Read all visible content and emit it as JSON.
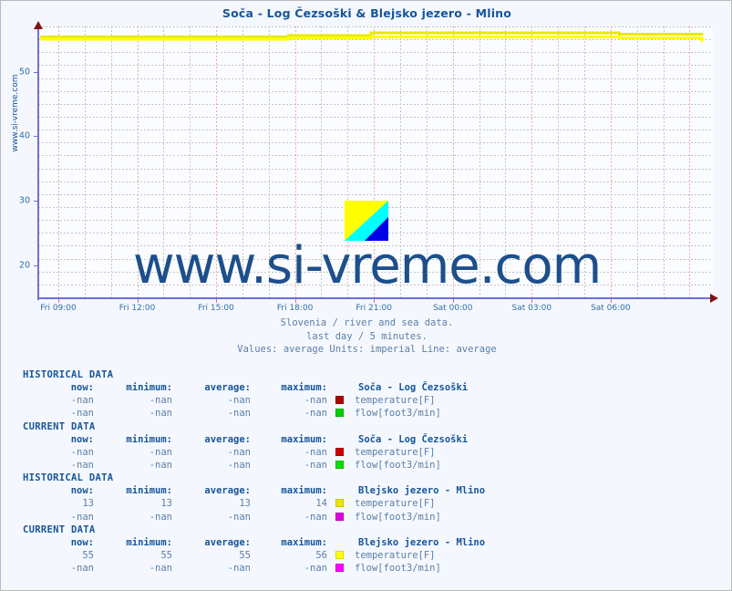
{
  "chart_title": "Soča - Log Čezsoški & Blejsko jezero - Mlino",
  "side_watermark": "www.si-vreme.com",
  "big_watermark": "www.si-vreme.com",
  "logo": {
    "name": "si-vreme-logo",
    "colors": {
      "top": "#ffff00",
      "middle": "#00ffff",
      "bottom": "#0000e6"
    }
  },
  "caption": {
    "line1": "Slovenia / river and sea data.",
    "line2": "last day / 5 minutes.",
    "line3": "Values: average  Units: imperial  Line: average"
  },
  "chart_data": {
    "type": "line",
    "title": "Soča - Log Čezsoški & Blejsko jezero - Mlino",
    "xlabel": "",
    "ylabel": "",
    "ylim": [
      15,
      57
    ],
    "yticks": [
      20,
      30,
      40,
      50
    ],
    "grid": true,
    "legend_position": "below-table",
    "x": [
      "Fri 09:00",
      "Fri 12:00",
      "Fri 15:00",
      "Fri 18:00",
      "Fri 21:00",
      "Sat 00:00",
      "Sat 03:00",
      "Sat 06:00"
    ],
    "xtick_labels": [
      "Fri 09:00",
      "Fri 12:00",
      "Fri 15:00",
      "Fri 18:00",
      "Fri 21:00",
      "Sat 00:00",
      "Sat 03:00",
      "Sat 06:00"
    ],
    "series": [
      {
        "name": "Blejsko jezero - Mlino temperature[F] (maximum)",
        "color": "#e8e800",
        "values": [
          55.4,
          55.4,
          55.4,
          55.6,
          56.0,
          56.0,
          56.0,
          55.8,
          55.6
        ]
      },
      {
        "name": "Blejsko jezero - Mlino temperature[F] (average)",
        "color": "#ffff00",
        "values": [
          55.0,
          55.0,
          55.0,
          55.2,
          55.4,
          55.4,
          55.4,
          55.2,
          54.6
        ]
      },
      {
        "name": "Soča - Log Čezsoški temperature[F]",
        "color": "#b00000",
        "values": [
          null,
          null,
          null,
          null,
          null,
          null,
          null,
          null,
          null
        ]
      },
      {
        "name": "Soča - Log Čezsoški flow[foot3/min]",
        "color": "#00d000",
        "values": [
          null,
          null,
          null,
          null,
          null,
          null,
          null,
          null,
          null
        ]
      },
      {
        "name": "Blejsko jezero - Mlino flow[foot3/min]",
        "color": "#ff00ff",
        "values": [
          null,
          null,
          null,
          null,
          null,
          null,
          null,
          null,
          null
        ]
      }
    ]
  },
  "columns": [
    "now:",
    "minimum:",
    "average:",
    "maximum:"
  ],
  "blocks": [
    {
      "title": "HISTORICAL DATA",
      "station": "Soča - Log Čezsoški",
      "rows": [
        {
          "now": "-nan",
          "minimum": "-nan",
          "average": "-nan",
          "maximum": "-nan",
          "color": "#b00000",
          "label": "temperature[F]"
        },
        {
          "now": "-nan",
          "minimum": "-nan",
          "average": "-nan",
          "maximum": "-nan",
          "color": "#00d000",
          "label": "flow[foot3/min]"
        }
      ]
    },
    {
      "title": "CURRENT DATA",
      "station": "Soča - Log Čezsoški",
      "rows": [
        {
          "now": "-nan",
          "minimum": "-nan",
          "average": "-nan",
          "maximum": "-nan",
          "color": "#cc0000",
          "label": "temperature[F]"
        },
        {
          "now": "-nan",
          "minimum": "-nan",
          "average": "-nan",
          "maximum": "-nan",
          "color": "#00e000",
          "label": "flow[foot3/min]"
        }
      ]
    },
    {
      "title": "HISTORICAL DATA",
      "station": "Blejsko jezero - Mlino",
      "rows": [
        {
          "now": "13",
          "minimum": "13",
          "average": "13",
          "maximum": "14",
          "color": "#e8e800",
          "label": "temperature[F]"
        },
        {
          "now": "-nan",
          "minimum": "-nan",
          "average": "-nan",
          "maximum": "-nan",
          "color": "#e000e0",
          "label": "flow[foot3/min]"
        }
      ]
    },
    {
      "title": "CURRENT DATA",
      "station": "Blejsko jezero - Mlino",
      "rows": [
        {
          "now": "55",
          "minimum": "55",
          "average": "55",
          "maximum": "56",
          "color": "#ffff00",
          "label": "temperature[F]"
        },
        {
          "now": "-nan",
          "minimum": "-nan",
          "average": "-nan",
          "maximum": "-nan",
          "color": "#ff00ff",
          "label": "flow[foot3/min]"
        }
      ]
    }
  ]
}
